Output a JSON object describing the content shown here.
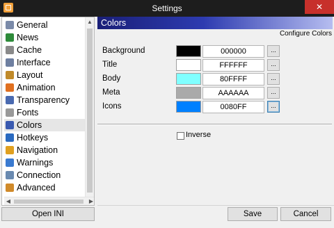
{
  "window": {
    "title": "Settings",
    "close_glyph": "✕"
  },
  "sidebar": {
    "items": [
      {
        "label": "General",
        "icon": "general-icon",
        "color": "#7a8aa8"
      },
      {
        "label": "News",
        "icon": "news-arrow-icon",
        "color": "#2e8b3a"
      },
      {
        "label": "Cache",
        "icon": "cache-icon",
        "color": "#8a8a8a"
      },
      {
        "label": "Interface",
        "icon": "interface-icon",
        "color": "#6e7fa0"
      },
      {
        "label": "Layout",
        "icon": "layout-icon",
        "color": "#c08a2a"
      },
      {
        "label": "Animation",
        "icon": "animation-icon",
        "color": "#e07020"
      },
      {
        "label": "Transparency",
        "icon": "transparency-icon",
        "color": "#4a6ab0"
      },
      {
        "label": "Fonts",
        "icon": "fonts-icon",
        "color": "#999999"
      },
      {
        "label": "Colors",
        "icon": "colors-icon",
        "color": "#3a5ab0"
      },
      {
        "label": "Hotkeys",
        "icon": "hotkeys-icon",
        "color": "#2a6ac0"
      },
      {
        "label": "Navigation",
        "icon": "navigation-icon",
        "color": "#e0a020"
      },
      {
        "label": "Warnings",
        "icon": "warnings-icon",
        "color": "#3a7ad0"
      },
      {
        "label": "Connection",
        "icon": "connection-icon",
        "color": "#6a8ab0"
      },
      {
        "label": "Advanced",
        "icon": "advanced-icon",
        "color": "#d08a2a"
      }
    ],
    "selected": "Colors"
  },
  "pane": {
    "title": "Colors",
    "subtitle": "Configure Colors",
    "rows": [
      {
        "label": "Background",
        "hex": "000000",
        "swatch": "#000000"
      },
      {
        "label": "Title",
        "hex": "FFFFFF",
        "swatch": "#FFFFFF"
      },
      {
        "label": "Body",
        "hex": "80FFFF",
        "swatch": "#80FFFF"
      },
      {
        "label": "Meta",
        "hex": "AAAAAA",
        "swatch": "#AAAAAA"
      },
      {
        "label": "Icons",
        "hex": "0080FF",
        "swatch": "#0080FF"
      }
    ],
    "pick_label": "...",
    "inverse_label": "Inverse",
    "inverse_checked": false
  },
  "buttons": {
    "open_ini": "Open INI",
    "save": "Save",
    "cancel": "Cancel"
  }
}
